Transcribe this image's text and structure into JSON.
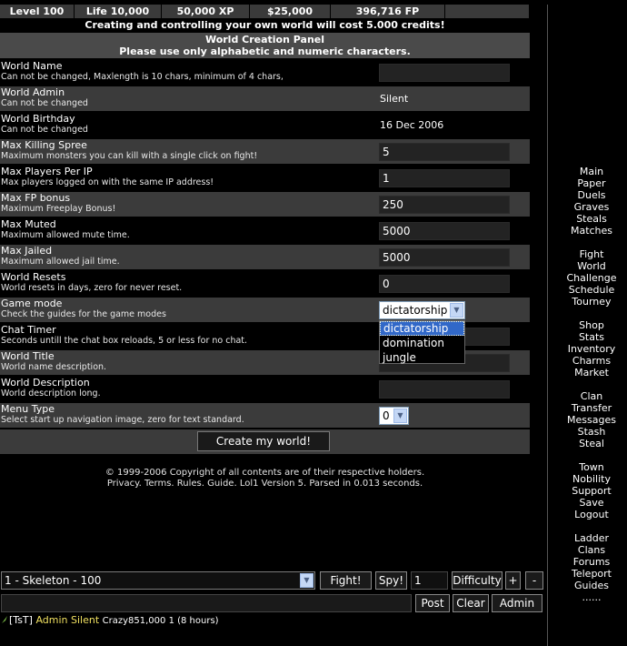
{
  "stats": [
    "Level 100",
    "Life 10,000",
    "50,000 XP",
    "$25,000",
    "396,716 FP"
  ],
  "notice": "Creating and controlling your own world will cost 5.000 credits!",
  "panel": {
    "title": "World Creation Panel",
    "subtitle": "Please use only alphabetic and numeric characters."
  },
  "fields": {
    "world_name": {
      "label": "World Name",
      "desc": "Can not be changed, Maxlength is 10 chars, minimum of 4 chars,",
      "value": ""
    },
    "world_admin": {
      "label": "World Admin",
      "desc": "Can not be changed",
      "value": "Silent"
    },
    "world_birthday": {
      "label": "World Birthday",
      "desc": "Can not be changed",
      "value": "16 Dec 2006"
    },
    "max_killing_spree": {
      "label": "Max Killing Spree",
      "desc": "Maximum monsters you can kill with a single click on fight!",
      "value": "5"
    },
    "max_players_ip": {
      "label": "Max Players Per IP",
      "desc": "Max players logged on with the same IP address!",
      "value": "1"
    },
    "max_fp_bonus": {
      "label": "Max FP bonus",
      "desc": "Maximum Freeplay Bonus!",
      "value": "250"
    },
    "max_muted": {
      "label": "Max Muted",
      "desc": "Maximum allowed mute time.",
      "value": "5000"
    },
    "max_jailed": {
      "label": "Max Jailed",
      "desc": "Maximum allowed jail time.",
      "value": "5000"
    },
    "world_resets": {
      "label": "World Resets",
      "desc": "World resets in days, zero for never reset.",
      "value": "0"
    },
    "game_mode": {
      "label": "Game mode",
      "desc": "Check the guides for the game modes",
      "value": "dictatorship",
      "options": [
        "dictatorship",
        "domination",
        "jungle"
      ]
    },
    "chat_timer": {
      "label": "Chat Timer",
      "desc": "Seconds untill the chat box reloads, 5 or less for no chat.",
      "value": ""
    },
    "world_title": {
      "label": "World Title",
      "desc": "World name description.",
      "value": ""
    },
    "world_description": {
      "label": "World Description",
      "desc": "World description long.",
      "value": ""
    },
    "menu_type": {
      "label": "Menu Type",
      "desc": "Select start up navigation image, zero for text standard.",
      "value": "0"
    }
  },
  "create_button": "Create my world!",
  "footer": {
    "copyright": "© 1999-2006 Copyright of all contents are of their respective holders.",
    "links": "Privacy. Terms. Rules. Guide. Lol1 Version 5. Parsed in 0.013 seconds."
  },
  "nav": {
    "group1": [
      "Main",
      "Paper",
      "Duels",
      "Graves",
      "Steals",
      "Matches"
    ],
    "group2": [
      "Fight",
      "World",
      "Challenge",
      "Schedule",
      "Tourney"
    ],
    "group3": [
      "Shop",
      "Stats",
      "Inventory",
      "Charms",
      "Market"
    ],
    "group4": [
      "Clan",
      "Transfer",
      "Messages",
      "Stash",
      "Steal"
    ],
    "group5": [
      "Town",
      "Nobility",
      "Support",
      "Save",
      "Logout"
    ],
    "group6": [
      "Ladder",
      "Clans",
      "Forums",
      "Teleport",
      "Guides",
      "......"
    ]
  },
  "bottom": {
    "monster": "1 - Skeleton - 100",
    "fight": "Fight!",
    "spy": "Spy!",
    "amount": "1",
    "difficulty": "Difficulty",
    "plus": "+",
    "minus": "-",
    "post": "Post",
    "clear": "Clear",
    "admin": "Admin",
    "chat_value": ""
  },
  "chat": {
    "tag": "[TsT]",
    "role": "Admin",
    "user": "Silent",
    "rest": "Crazy851,000 1 (8 hours)"
  },
  "colors": {
    "background": "#000000",
    "row_shade": "#3b3b3b",
    "stat_bg": "#3a3a3a",
    "admin_name": "#f0e060",
    "selected_option": "#3168c8"
  }
}
